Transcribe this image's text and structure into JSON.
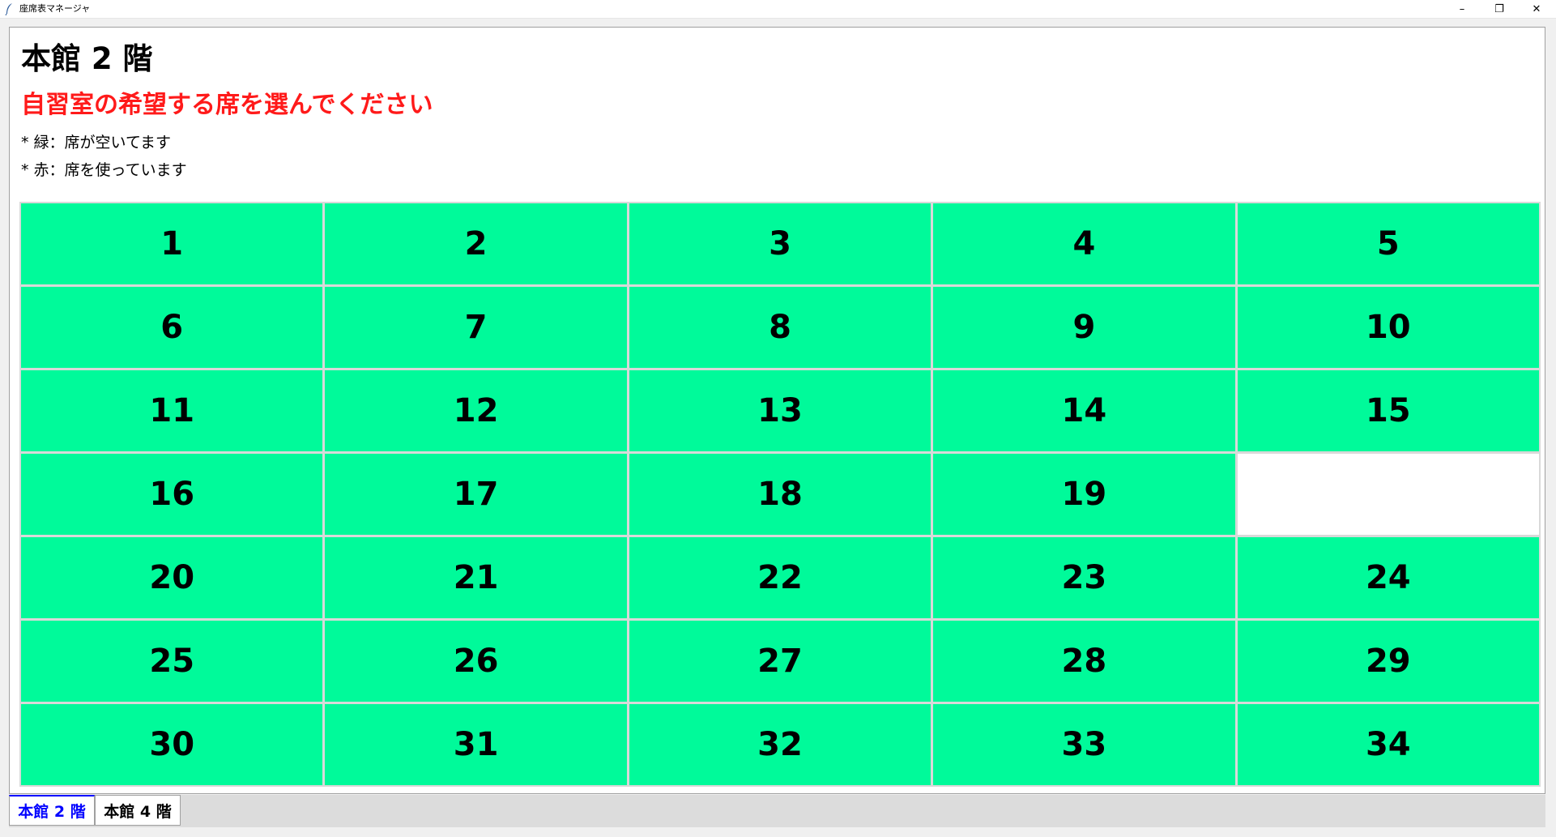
{
  "window": {
    "title": "座席表マネージャ",
    "controls": {
      "minimize": "–",
      "maximize": "❐",
      "close": "✕"
    }
  },
  "page": {
    "heading": "本館 2 階",
    "subheading": "自習室の希望する席を選んでください",
    "notes": [
      "* 緑：席が空いてます",
      "* 赤：席を使っています"
    ]
  },
  "colors": {
    "vacant": "#00fa9a",
    "occupied": "#ff1a1a",
    "subheading": "#ff1a1a",
    "active_tab": "#0000ff"
  },
  "seats": [
    {
      "label": "1",
      "status": "vacant"
    },
    {
      "label": "2",
      "status": "vacant"
    },
    {
      "label": "3",
      "status": "vacant"
    },
    {
      "label": "4",
      "status": "vacant"
    },
    {
      "label": "5",
      "status": "vacant"
    },
    {
      "label": "6",
      "status": "vacant"
    },
    {
      "label": "7",
      "status": "vacant"
    },
    {
      "label": "8",
      "status": "vacant"
    },
    {
      "label": "9",
      "status": "vacant"
    },
    {
      "label": "10",
      "status": "vacant"
    },
    {
      "label": "11",
      "status": "vacant"
    },
    {
      "label": "12",
      "status": "vacant"
    },
    {
      "label": "13",
      "status": "vacant"
    },
    {
      "label": "14",
      "status": "vacant"
    },
    {
      "label": "15",
      "status": "vacant"
    },
    {
      "label": "16",
      "status": "vacant"
    },
    {
      "label": "17",
      "status": "vacant"
    },
    {
      "label": "18",
      "status": "vacant"
    },
    {
      "label": "19",
      "status": "vacant"
    },
    {
      "label": "",
      "status": "empty"
    },
    {
      "label": "20",
      "status": "vacant"
    },
    {
      "label": "21",
      "status": "vacant"
    },
    {
      "label": "22",
      "status": "vacant"
    },
    {
      "label": "23",
      "status": "vacant"
    },
    {
      "label": "24",
      "status": "vacant"
    },
    {
      "label": "25",
      "status": "vacant"
    },
    {
      "label": "26",
      "status": "vacant"
    },
    {
      "label": "27",
      "status": "vacant"
    },
    {
      "label": "28",
      "status": "vacant"
    },
    {
      "label": "29",
      "status": "vacant"
    },
    {
      "label": "30",
      "status": "vacant"
    },
    {
      "label": "31",
      "status": "vacant"
    },
    {
      "label": "32",
      "status": "vacant"
    },
    {
      "label": "33",
      "status": "vacant"
    },
    {
      "label": "34",
      "status": "vacant"
    }
  ],
  "tabs": [
    {
      "label": "本館 2 階",
      "selected": true
    },
    {
      "label": "本館 4 階",
      "selected": false
    }
  ]
}
